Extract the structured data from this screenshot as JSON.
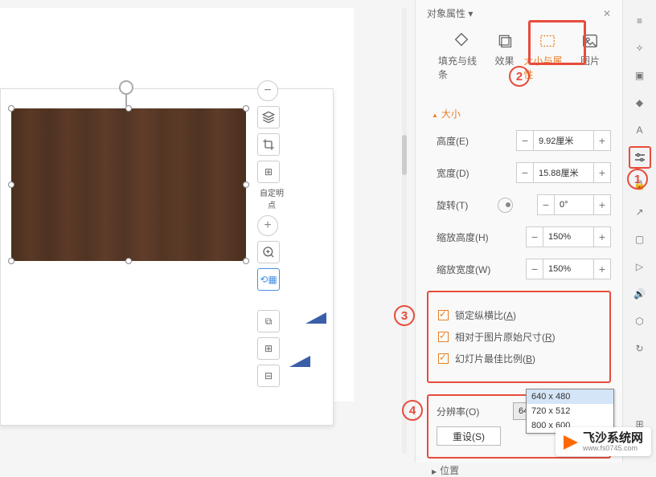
{
  "panel": {
    "title": "对象属性 ▾",
    "tabs": {
      "fill": "填充与线条",
      "effect": "效果",
      "size": "大小与属性",
      "pic": "图片"
    },
    "section_size": "大小",
    "height_label": "高度(E)",
    "height_value": "9.92厘米",
    "width_label": "宽度(D)",
    "width_value": "15.88厘米",
    "rotate_label": "旋转(T)",
    "rotate_value": "0°",
    "scale_h_label": "缩放高度(H)",
    "scale_h_value": "150%",
    "scale_w_label": "缩放宽度(W)",
    "scale_w_value": "150%",
    "lock_aspect": "锁定纵横比(",
    "lock_aspect_u": "A",
    "lock_aspect_end": ")",
    "relative_orig": "相对于图片原始尺寸(",
    "relative_orig_u": "R",
    "relative_orig_end": ")",
    "slide_best": "幻灯片最佳比例(",
    "slide_best_u": "B",
    "slide_best_end": ")",
    "resolution_label": "分辨率(O)",
    "resolution_value": "640 x 480",
    "reset_label": "重设(S)",
    "dd_items": [
      "640 x 480",
      "720 x 512",
      "800 x 600"
    ],
    "position": "位置"
  },
  "tools": {
    "label_custom": "自定明点"
  },
  "annotations": {
    "n1": "1",
    "n2": "2",
    "n3": "3",
    "n4": "4"
  },
  "watermark": {
    "main": "飞沙系统网",
    "sub": "www.fs0745.com"
  }
}
